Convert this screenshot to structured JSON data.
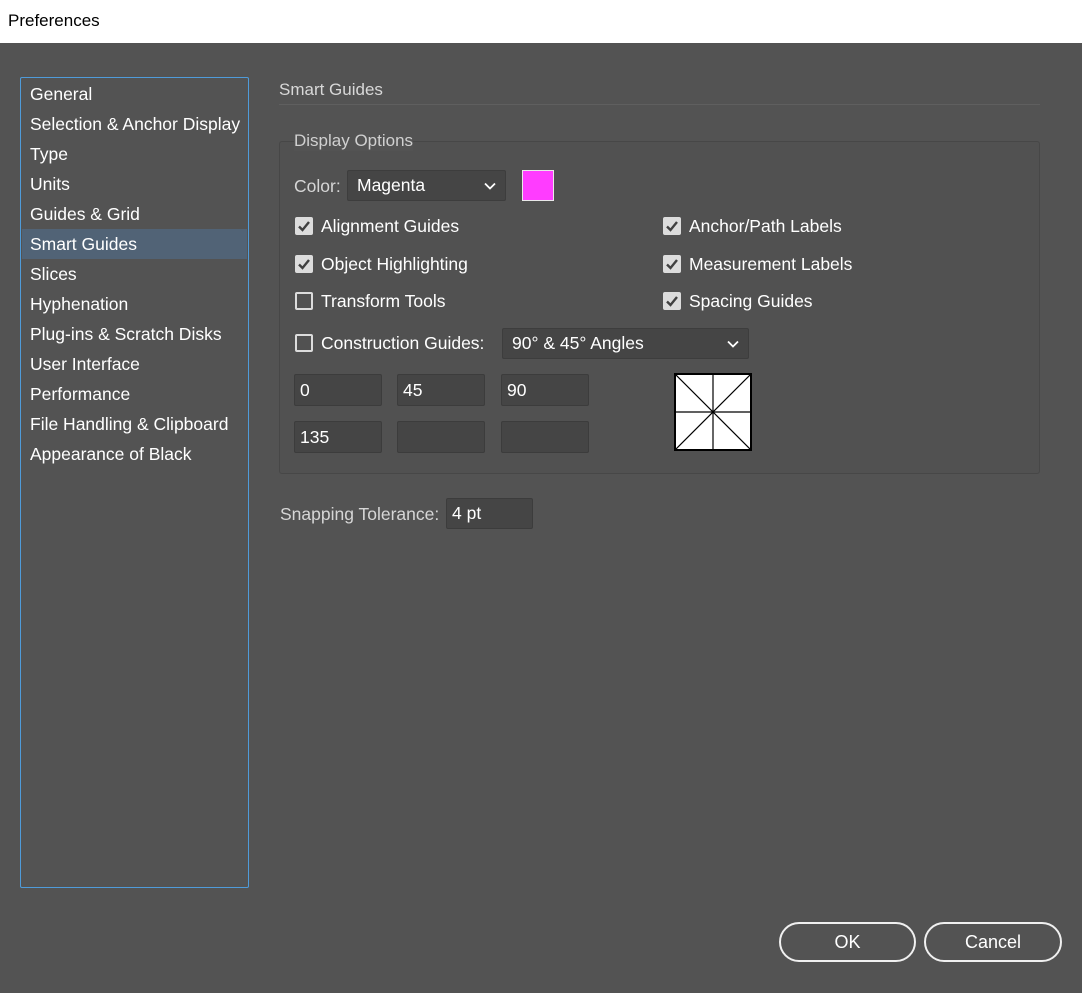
{
  "window": {
    "title": "Preferences"
  },
  "sidebar": {
    "items": [
      {
        "label": "General",
        "selected": false
      },
      {
        "label": "Selection & Anchor Display",
        "selected": false
      },
      {
        "label": "Type",
        "selected": false
      },
      {
        "label": "Units",
        "selected": false
      },
      {
        "label": "Guides & Grid",
        "selected": false
      },
      {
        "label": "Smart Guides",
        "selected": true
      },
      {
        "label": "Slices",
        "selected": false
      },
      {
        "label": "Hyphenation",
        "selected": false
      },
      {
        "label": "Plug-ins & Scratch Disks",
        "selected": false
      },
      {
        "label": "User Interface",
        "selected": false
      },
      {
        "label": "Performance",
        "selected": false
      },
      {
        "label": "File Handling & Clipboard",
        "selected": false
      },
      {
        "label": "Appearance of Black",
        "selected": false
      }
    ]
  },
  "main": {
    "section_title": "Smart Guides",
    "display_options": {
      "group_label": "Display Options",
      "color_label": "Color:",
      "color_value": "Magenta",
      "color_swatch": "#ff3cff",
      "checkboxes": {
        "alignment_guides": {
          "label": "Alignment Guides",
          "checked": true
        },
        "anchor_path_labels": {
          "label": "Anchor/Path Labels",
          "checked": true
        },
        "object_highlighting": {
          "label": "Object Highlighting",
          "checked": true
        },
        "measurement_labels": {
          "label": "Measurement Labels",
          "checked": true
        },
        "transform_tools": {
          "label": "Transform Tools",
          "checked": false
        },
        "spacing_guides": {
          "label": "Spacing Guides",
          "checked": true
        },
        "construction_guides": {
          "label": "Construction Guides:",
          "checked": false
        }
      },
      "construction_angles_value": "90° & 45° Angles",
      "angle_fields": [
        "0",
        "45",
        "90",
        "135",
        "",
        ""
      ]
    },
    "snapping_tolerance": {
      "label": "Snapping Tolerance:",
      "value": "4 pt"
    }
  },
  "buttons": {
    "ok": "OK",
    "cancel": "Cancel"
  },
  "icons": {
    "chevron": "chevron-down-icon",
    "check": "checkmark-icon"
  }
}
